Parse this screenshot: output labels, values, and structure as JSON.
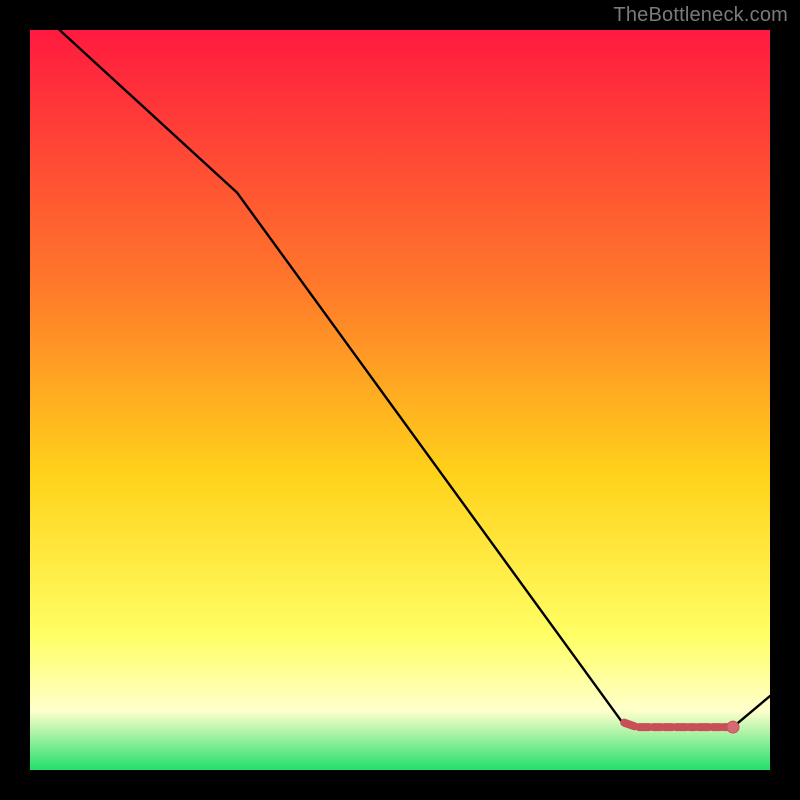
{
  "watermark": "TheBottleneck.com",
  "colors": {
    "grad_top": "#ff1a3f",
    "grad_upper_mid": "#ff7a2a",
    "grad_mid": "#ffd21a",
    "grad_lower_mid": "#ffff66",
    "grad_pale": "#ffffcc",
    "grad_green": "#22e06b",
    "line": "#000000",
    "marker_stroke": "#c94e57",
    "marker_fill": "#d66a72",
    "bg": "#000000"
  },
  "chart_data": {
    "type": "line",
    "title": "",
    "xlabel": "",
    "ylabel": "",
    "xlim": [
      0,
      100
    ],
    "ylim": [
      0,
      100
    ],
    "grid": false,
    "legend": false,
    "series": [
      {
        "name": "curve",
        "x": [
          4,
          28,
          80,
          82,
          95,
          100
        ],
        "y": [
          100,
          78,
          6.5,
          5.8,
          5.8,
          10
        ]
      }
    ],
    "markers": {
      "name": "highlight-segment",
      "x": [
        80,
        82,
        84,
        85.5,
        87,
        89,
        90,
        92,
        93.5,
        95
      ],
      "y": [
        6.5,
        5.8,
        5.8,
        5.8,
        5.8,
        5.8,
        5.8,
        5.8,
        5.8,
        5.8
      ]
    },
    "dot": {
      "x": 95,
      "y": 5.8
    }
  }
}
